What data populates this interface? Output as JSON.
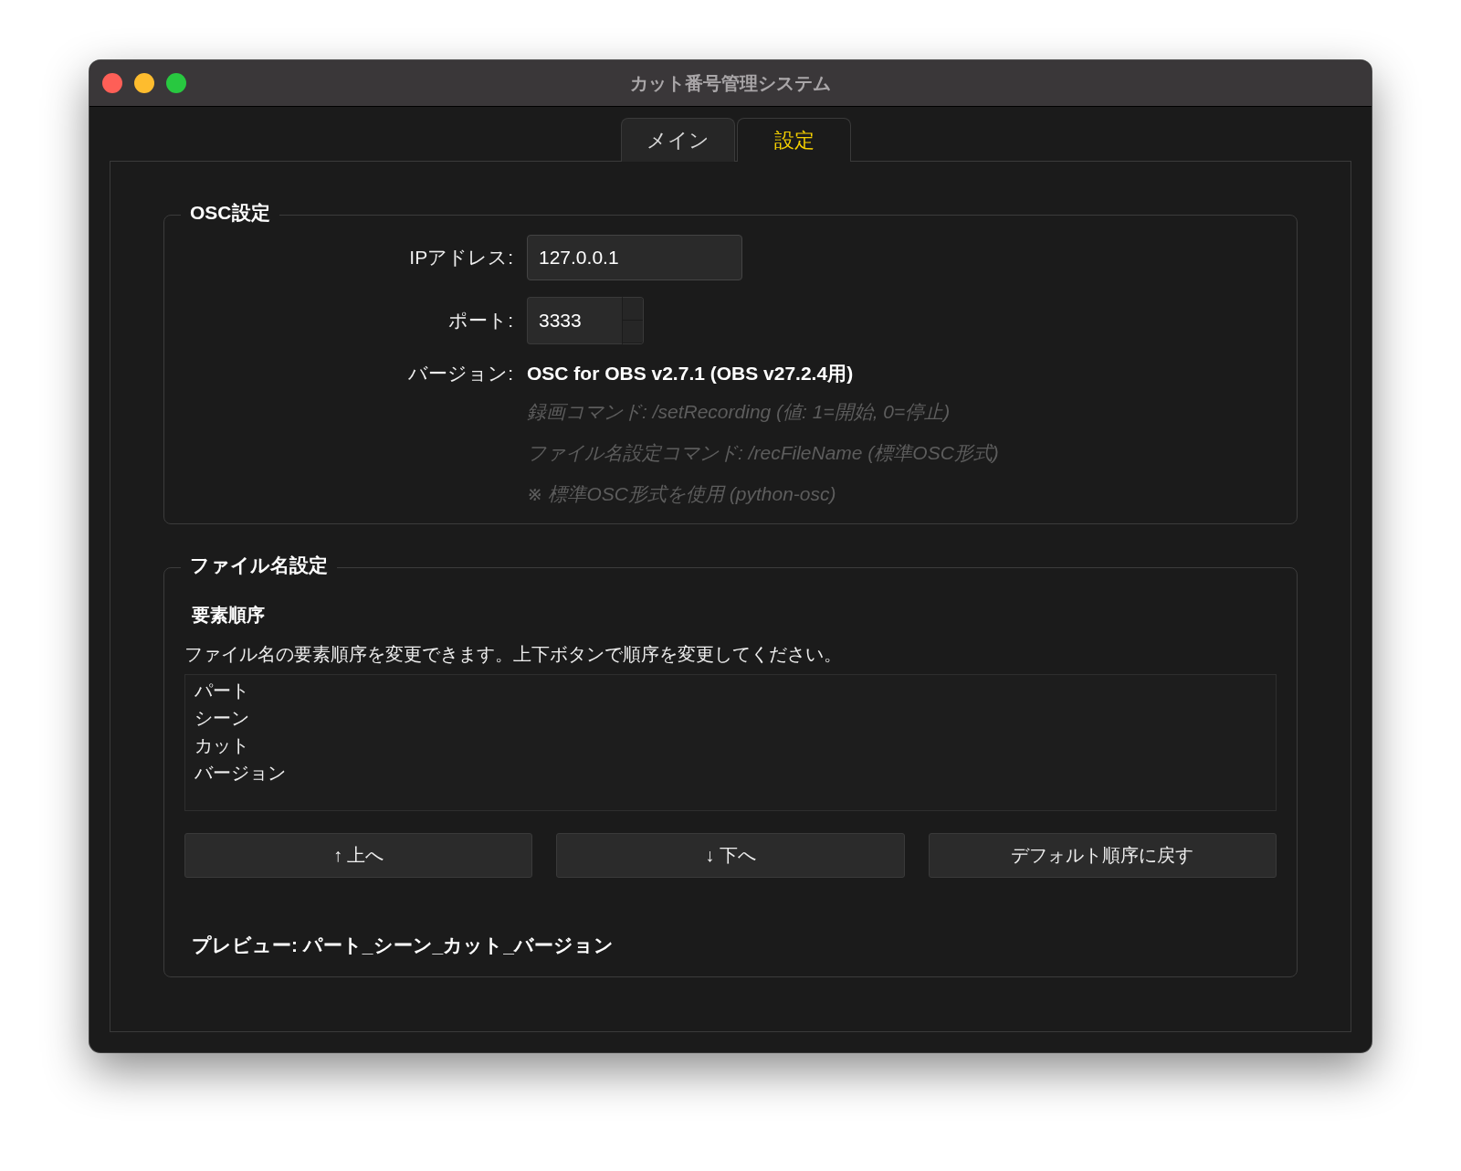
{
  "window": {
    "title": "カット番号管理システム"
  },
  "tabs": [
    {
      "label": "メイン",
      "selected": false
    },
    {
      "label": "設定",
      "selected": true
    }
  ],
  "osc_settings": {
    "title": "OSC設定",
    "ip_label": "IPアドレス:",
    "ip_value": "127.0.0.1",
    "port_label": "ポート:",
    "port_value": "3333",
    "version_label": "バージョン:",
    "version_value": "OSC for OBS v2.7.1 (OBS v27.2.4用)",
    "notes": [
      "録画コマンド: /setRecording (値: 1=開始, 0=停止)",
      "ファイル名設定コマンド: /recFileName (標準OSC形式)",
      "※ 標準OSC形式を使用 (python-osc)"
    ]
  },
  "filename_settings": {
    "title": "ファイル名設定",
    "subtitle": "要素順序",
    "description": "ファイル名の要素順序を変更できます。上下ボタンで順序を変更してください。",
    "elements": [
      "パート",
      "シーン",
      "カット",
      "バージョン"
    ],
    "buttons": [
      "↑ 上へ",
      "↓ 下へ",
      "デフォルト順序に戻す"
    ],
    "preview": "プレビュー: パート_シーン_カット_バージョン"
  }
}
